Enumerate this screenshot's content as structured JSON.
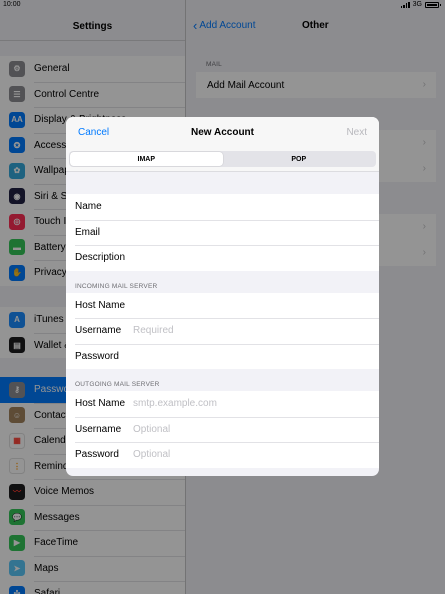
{
  "status": {
    "time": "10:00",
    "network": "3G"
  },
  "settings": {
    "title": "Settings",
    "group1": [
      {
        "label": "General",
        "icon": "gear-icon",
        "color": "#8e8e93",
        "glyph": "⚙"
      },
      {
        "label": "Control Centre",
        "icon": "toggles-icon",
        "color": "#8e8e93",
        "glyph": "☰"
      },
      {
        "label": "Display & Brightness",
        "icon": "aa-icon",
        "color": "#007aff",
        "glyph": "AA"
      },
      {
        "label": "Accessibility",
        "icon": "accessibility-icon",
        "color": "#007aff",
        "glyph": "✪"
      },
      {
        "label": "Wallpaper",
        "icon": "flower-icon",
        "color": "#34aadc",
        "glyph": "✿"
      },
      {
        "label": "Siri & Search",
        "icon": "siri-icon",
        "color": "#222244",
        "glyph": "◉"
      },
      {
        "label": "Touch ID & Passcode",
        "icon": "fingerprint-icon",
        "color": "#ff2d55",
        "glyph": "◎"
      },
      {
        "label": "Battery",
        "icon": "battery-icon",
        "color": "#34c759",
        "glyph": "▬"
      },
      {
        "label": "Privacy",
        "icon": "hand-icon",
        "color": "#007aff",
        "glyph": "✋"
      }
    ],
    "group2": [
      {
        "label": "iTunes & App Store",
        "icon": "app-store-icon",
        "color": "#1a8cff",
        "glyph": "A"
      },
      {
        "label": "Wallet & Apple Pay",
        "icon": "wallet-icon",
        "color": "#1c1c1e",
        "glyph": "▤"
      }
    ],
    "group3": [
      {
        "label": "Passwords & Accounts",
        "icon": "key-icon",
        "color": "#8e8e93",
        "glyph": "⚷",
        "selected": true
      },
      {
        "label": "Contacts",
        "icon": "contacts-icon",
        "color": "#a2845e",
        "glyph": "☺"
      },
      {
        "label": "Calendar",
        "icon": "calendar-icon",
        "color": "#ffffff",
        "glyph": "▦",
        "glyphColor": "#ff3b30"
      },
      {
        "label": "Reminders",
        "icon": "reminders-icon",
        "color": "#ffffff",
        "glyph": "⋮",
        "glyphColor": "#ff9500"
      },
      {
        "label": "Voice Memos",
        "icon": "voice-memos-icon",
        "color": "#1c1c1e",
        "glyph": "〰",
        "glyphColor": "#ff3b30"
      },
      {
        "label": "Messages",
        "icon": "messages-icon",
        "color": "#34c759",
        "glyph": "💬"
      },
      {
        "label": "FaceTime",
        "icon": "facetime-icon",
        "color": "#34c759",
        "glyph": "▶"
      },
      {
        "label": "Maps",
        "icon": "maps-icon",
        "color": "#5ac8fa",
        "glyph": "➤"
      },
      {
        "label": "Safari",
        "icon": "safari-icon",
        "color": "#007aff",
        "glyph": "✣"
      }
    ]
  },
  "other": {
    "back_label": "Add Account",
    "title": "Other",
    "mail_section": "MAIL",
    "add_mail": "Add Mail Account"
  },
  "modal": {
    "cancel": "Cancel",
    "title": "New Account",
    "next": "Next",
    "tabs": [
      "IMAP",
      "POP"
    ],
    "active_tab": "IMAP",
    "account_fields": [
      {
        "label": "Name",
        "placeholder": ""
      },
      {
        "label": "Email",
        "placeholder": ""
      },
      {
        "label": "Description",
        "placeholder": ""
      }
    ],
    "incoming_label": "INCOMING MAIL SERVER",
    "incoming_fields": [
      {
        "label": "Host Name",
        "placeholder": ""
      },
      {
        "label": "Username",
        "placeholder": "Required"
      },
      {
        "label": "Password",
        "placeholder": ""
      }
    ],
    "outgoing_label": "OUTGOING MAIL SERVER",
    "outgoing_fields": [
      {
        "label": "Host Name",
        "placeholder": "smtp.example.com"
      },
      {
        "label": "Username",
        "placeholder": "Optional"
      },
      {
        "label": "Password",
        "placeholder": "Optional"
      }
    ]
  }
}
